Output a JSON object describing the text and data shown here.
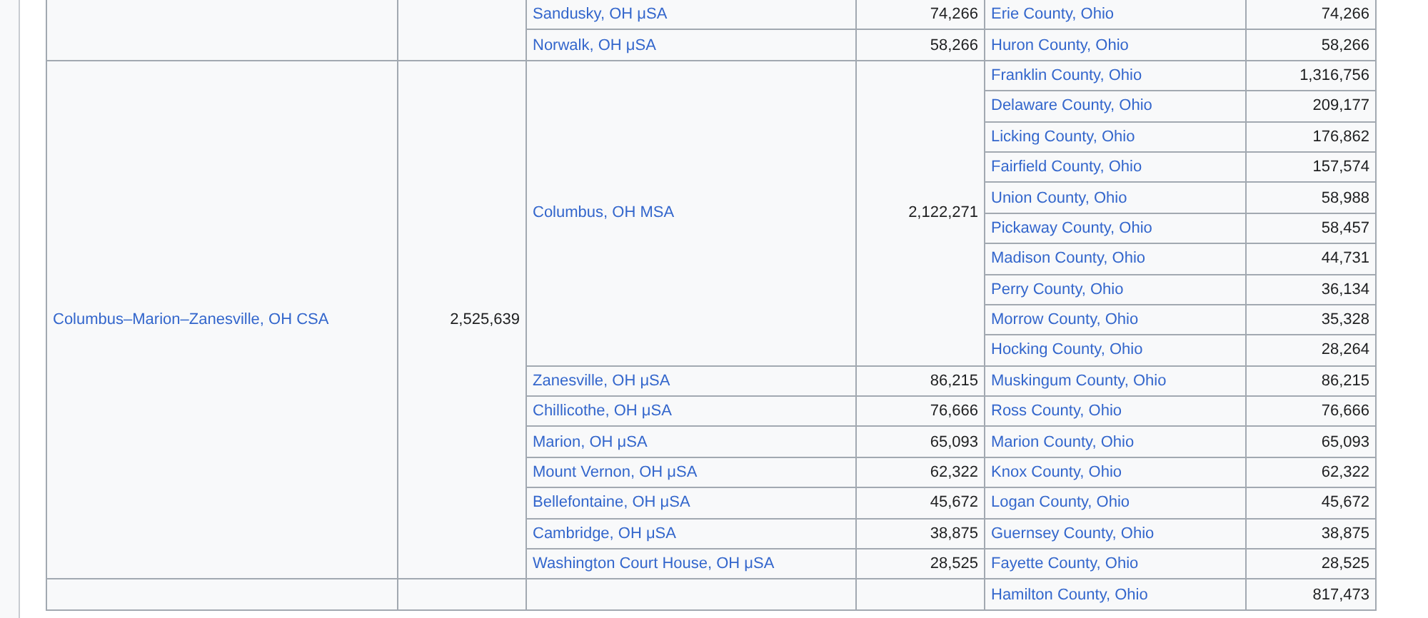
{
  "table": {
    "csas": [
      {
        "msas": [
          {
            "name": "Sandusky, OH μSA",
            "population": "74,266",
            "counties": [
              {
                "name": "Erie County, Ohio",
                "population": "74,266"
              }
            ]
          },
          {
            "name": "Norwalk, OH μSA",
            "population": "58,266",
            "counties": [
              {
                "name": "Huron County, Ohio",
                "population": "58,266"
              }
            ]
          }
        ]
      },
      {
        "name": "Columbus–Marion–Zanesville, OH CSA",
        "population": "2,525,639",
        "msas": [
          {
            "name": "Columbus, OH MSA",
            "population": "2,122,271",
            "counties": [
              {
                "name": "Franklin County, Ohio",
                "population": "1,316,756"
              },
              {
                "name": "Delaware County, Ohio",
                "population": "209,177"
              },
              {
                "name": "Licking County, Ohio",
                "population": "176,862"
              },
              {
                "name": "Fairfield County, Ohio",
                "population": "157,574"
              },
              {
                "name": "Union County, Ohio",
                "population": "58,988"
              },
              {
                "name": "Pickaway County, Ohio",
                "population": "58,457"
              },
              {
                "name": "Madison County, Ohio",
                "population": "44,731"
              },
              {
                "name": "Perry County, Ohio",
                "population": "36,134"
              },
              {
                "name": "Morrow County, Ohio",
                "population": "35,328"
              },
              {
                "name": "Hocking County, Ohio",
                "population": "28,264"
              }
            ]
          },
          {
            "name": "Zanesville, OH μSA",
            "population": "86,215",
            "counties": [
              {
                "name": "Muskingum County, Ohio",
                "population": "86,215"
              }
            ]
          },
          {
            "name": "Chillicothe, OH μSA",
            "population": "76,666",
            "counties": [
              {
                "name": "Ross County, Ohio",
                "population": "76,666"
              }
            ]
          },
          {
            "name": "Marion, OH μSA",
            "population": "65,093",
            "counties": [
              {
                "name": "Marion County, Ohio",
                "population": "65,093"
              }
            ]
          },
          {
            "name": "Mount Vernon, OH μSA",
            "population": "62,322",
            "counties": [
              {
                "name": "Knox County, Ohio",
                "population": "62,322"
              }
            ]
          },
          {
            "name": "Bellefontaine, OH μSA",
            "population": "45,672",
            "counties": [
              {
                "name": "Logan County, Ohio",
                "population": "45,672"
              }
            ]
          },
          {
            "name": "Cambridge, OH μSA",
            "population": "38,875",
            "counties": [
              {
                "name": "Guernsey County, Ohio",
                "population": "38,875"
              }
            ]
          },
          {
            "name": "Washington Court House, OH μSA",
            "population": "28,525",
            "counties": [
              {
                "name": "Fayette County, Ohio",
                "population": "28,525"
              }
            ]
          }
        ]
      },
      {
        "msas": [
          {
            "counties": [
              {
                "name": "Hamilton County, Ohio",
                "population": "817,473"
              }
            ]
          }
        ]
      }
    ]
  }
}
